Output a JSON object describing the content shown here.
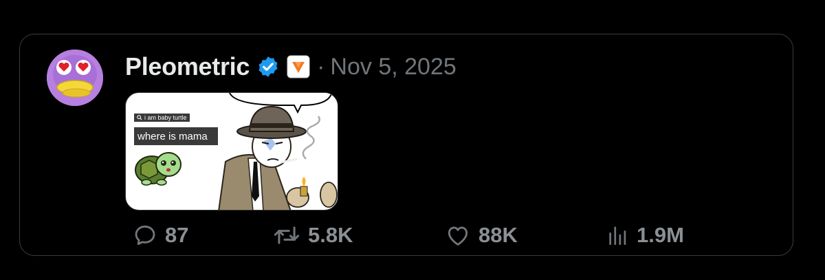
{
  "post": {
    "author_name": "Pleometric",
    "date": "Nov 5, 2025",
    "separator": "·",
    "media": {
      "search_text": "i am baby turtle",
      "caption": "where is mama"
    }
  },
  "actions": {
    "replies": "87",
    "reposts": "5.8K",
    "likes": "88K",
    "views": "1.9M"
  },
  "icons": {
    "verified": "verified-badge-icon",
    "affiliation": "affiliation-badge-icon",
    "reply": "comment-icon",
    "repost": "repost-icon",
    "like": "heart-icon",
    "views": "views-bar-chart-icon"
  },
  "colors": {
    "background": "#000000",
    "verified_blue": "#1d9bf0",
    "muted_text": "#71767b",
    "affiliation_orange": "#f47a20"
  }
}
